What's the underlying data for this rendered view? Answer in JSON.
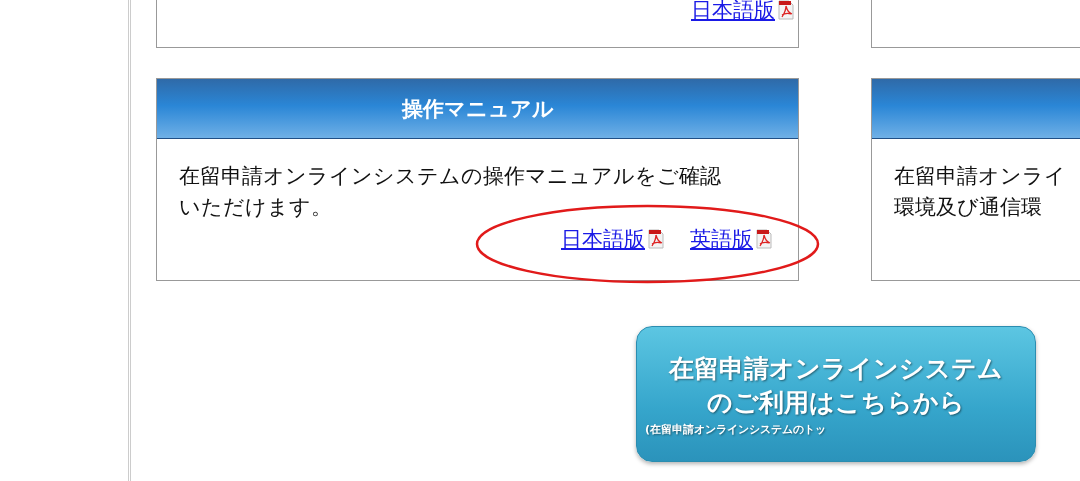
{
  "top_card": {
    "links": [
      {
        "label": "日本語版",
        "kind": "pdf"
      }
    ]
  },
  "cards": [
    {
      "title": "操作マニュアル",
      "body": "在留申請オンラインシステムの操作マニュアルをご確認いただけます。",
      "links": [
        {
          "label": "日本語版",
          "kind": "pdf"
        },
        {
          "label": "英語版",
          "kind": "pdf"
        }
      ]
    },
    {
      "lines": [
        "在留申請オンライ",
        "環境及び通信環"
      ]
    }
  ],
  "cta": {
    "lines": [
      "在留申請オンラインシステム",
      "のご利用はこちらから"
    ],
    "note": "(在留申請オンラインシステムのトッ"
  }
}
